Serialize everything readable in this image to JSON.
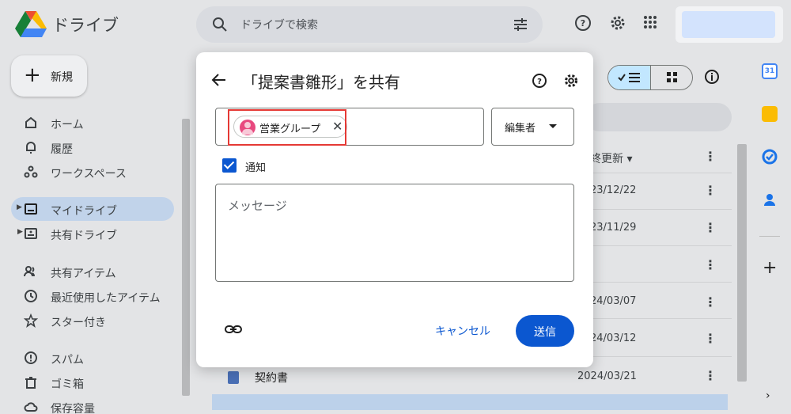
{
  "app": {
    "name": "ドライブ",
    "search_placeholder": "ドライブで検索"
  },
  "sidebar": {
    "new_label": "新規",
    "items": [
      {
        "label": "ホーム",
        "icon": "home-icon"
      },
      {
        "label": "履歴",
        "icon": "bell-icon"
      },
      {
        "label": "ワークスペース",
        "icon": "workspaces-icon"
      },
      {
        "label": "マイドライブ",
        "icon": "my-drive-icon",
        "active": true
      },
      {
        "label": "共有ドライブ",
        "icon": "shared-drive-icon"
      },
      {
        "label": "共有アイテム",
        "icon": "people-icon"
      },
      {
        "label": "最近使用したアイテム",
        "icon": "clock-icon"
      },
      {
        "label": "スター付き",
        "icon": "star-icon"
      },
      {
        "label": "スパム",
        "icon": "spam-icon"
      },
      {
        "label": "ゴミ箱",
        "icon": "trash-icon"
      },
      {
        "label": "保存容量",
        "icon": "cloud-icon"
      }
    ]
  },
  "file_list": {
    "column_header": "終更新",
    "dates": [
      "23/12/22",
      "23/11/29",
      "",
      "24/03/07",
      "24/03/12"
    ],
    "contract_name": "契約書",
    "contract_date": "2024/03/21"
  },
  "dialog": {
    "title": "「提案書雛形」を共有",
    "chip_label": "営業グループ",
    "role_label": "編集者",
    "notify_label": "通知",
    "notify_checked": true,
    "message_placeholder": "メッセージ",
    "cancel_label": "キャンセル",
    "send_label": "送信"
  },
  "colors": {
    "primary": "#0b57d0",
    "highlight": "#e53935",
    "chip_avatar": "#e8497f"
  }
}
